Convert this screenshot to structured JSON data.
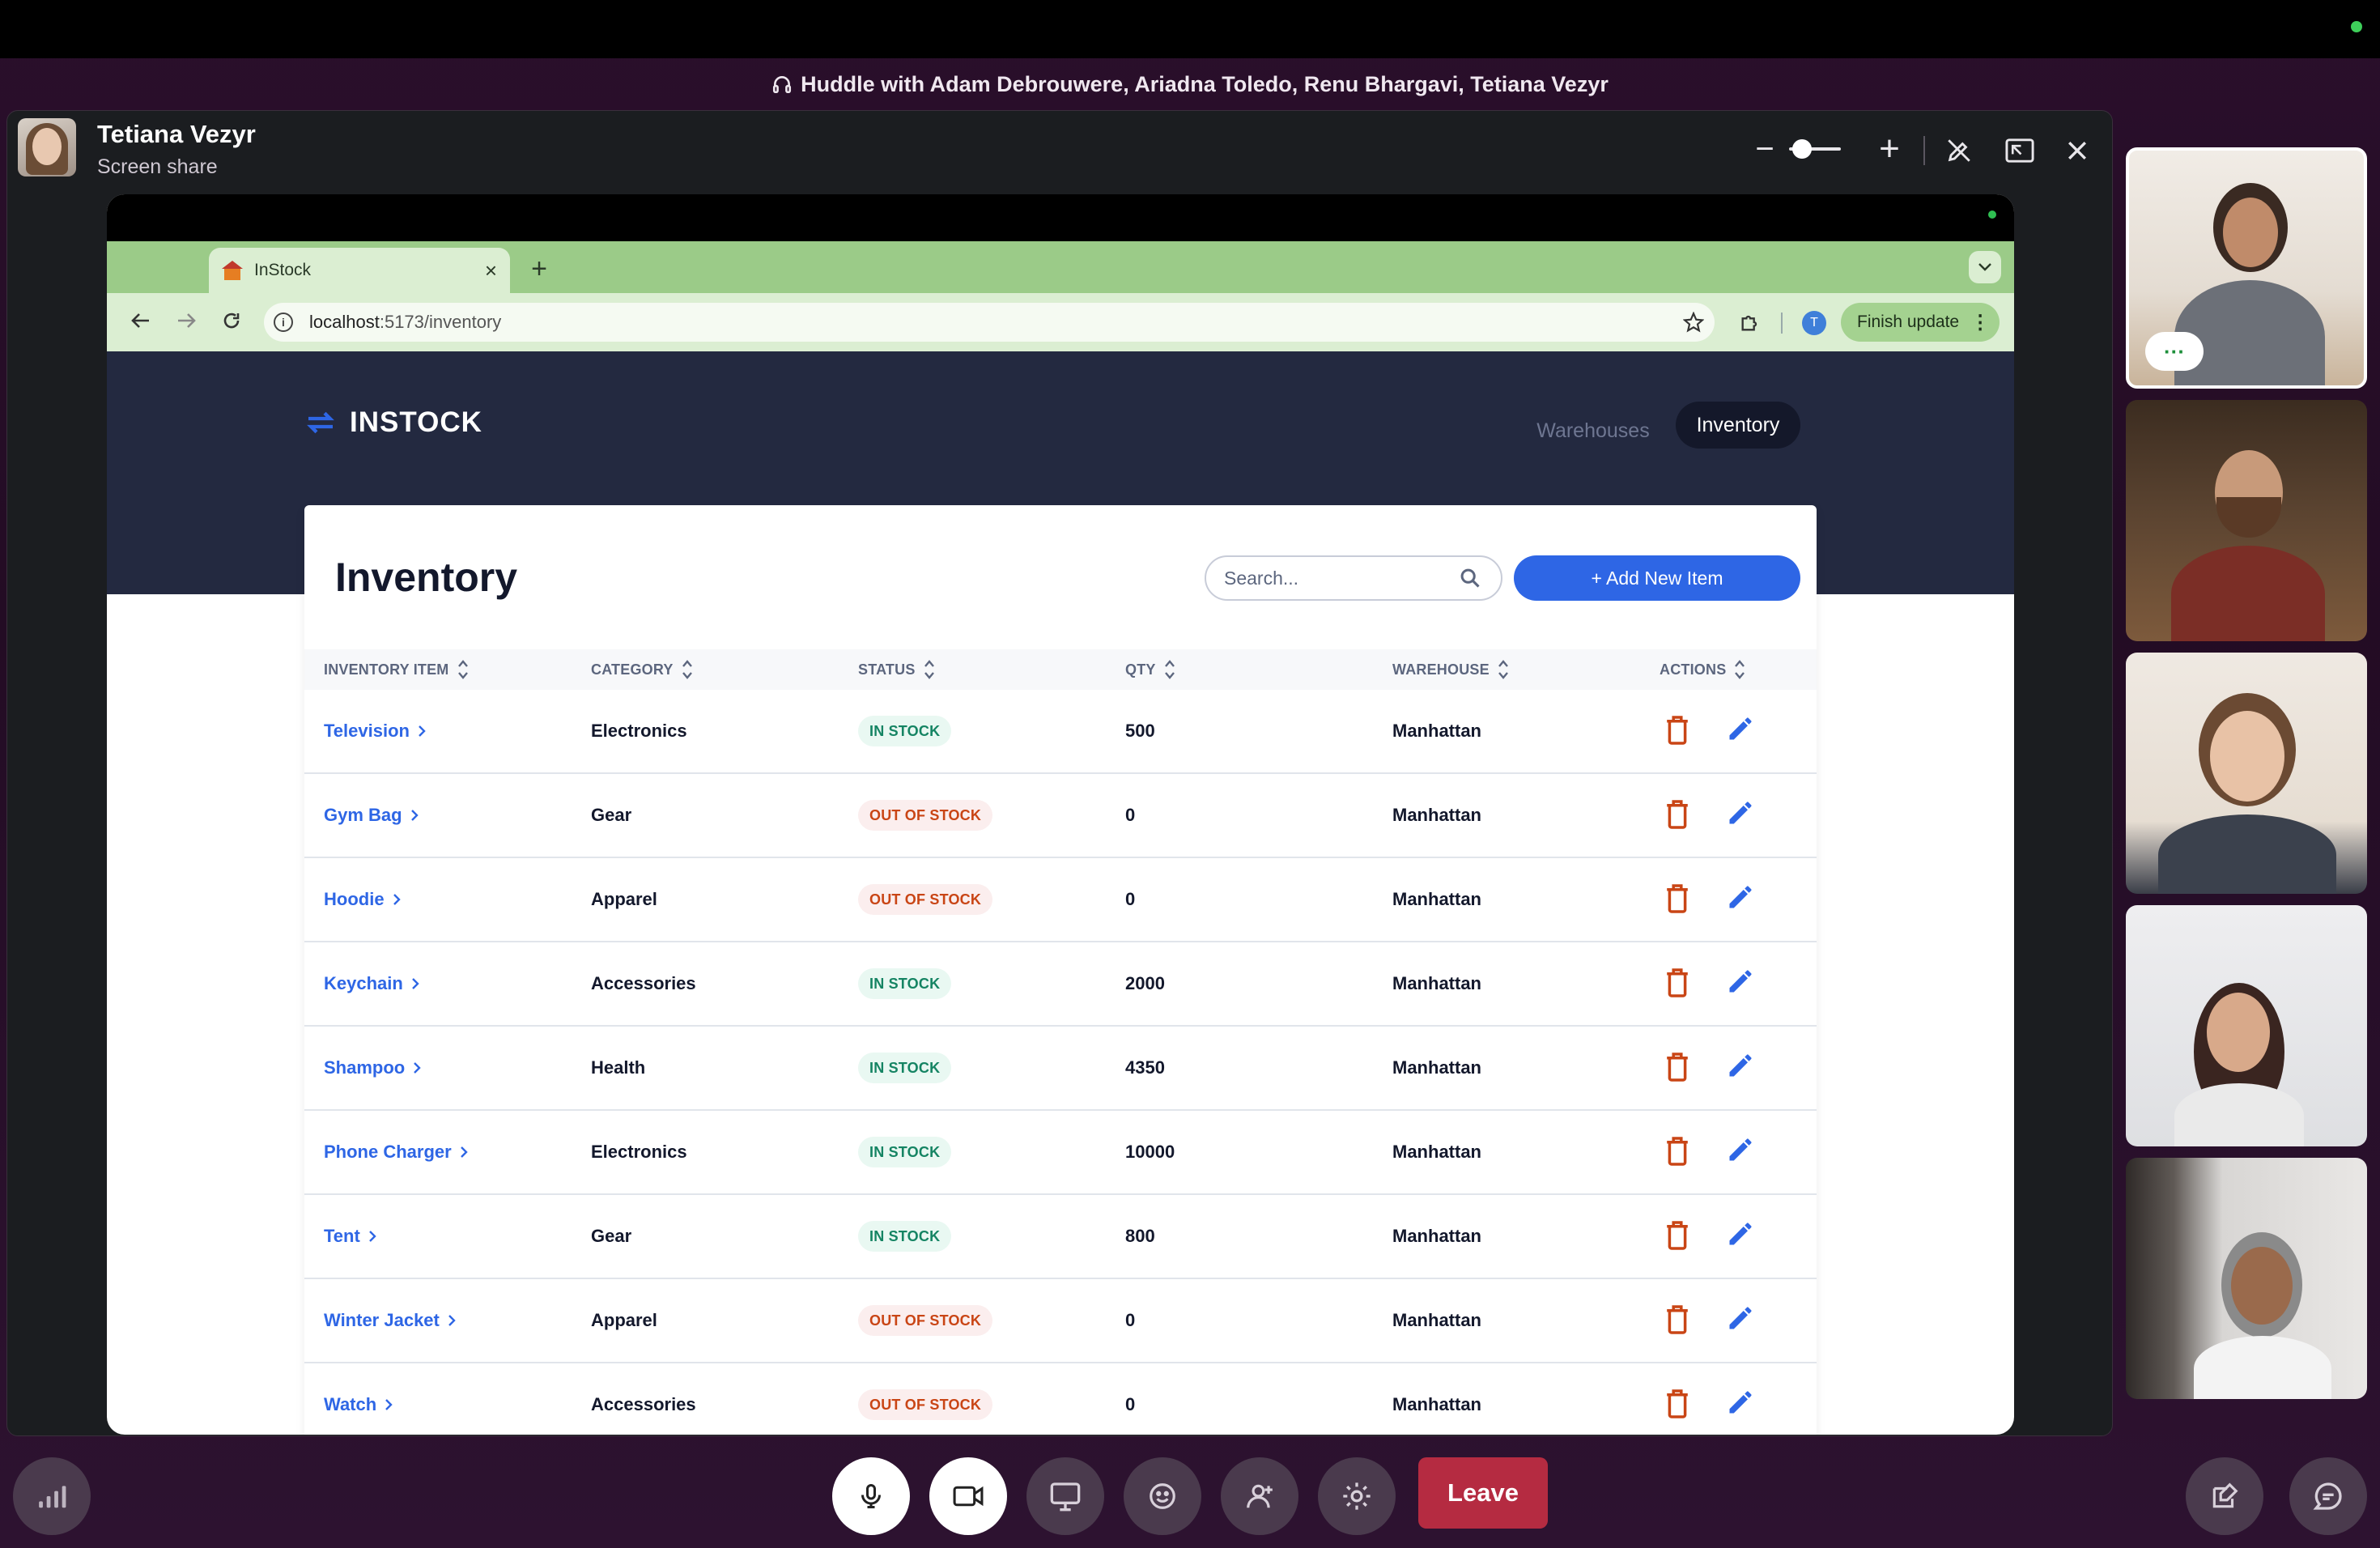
{
  "huddle": {
    "title": "Huddle with Adam Debrouwere, Ariadna Toledo, Renu Bhargavi, Tetiana Vezyr"
  },
  "share": {
    "sharer_name": "Tetiana Vezyr",
    "sharer_sub": "Screen share",
    "controls": {
      "zoom_out": "−",
      "zoom_in": "+"
    }
  },
  "browser": {
    "tab_title": "InStock",
    "tab_close": "×",
    "new_tab": "+",
    "url_host": "localhost",
    "url_path": ":5173/inventory",
    "profile_initial": "T",
    "finish_update": "Finish update"
  },
  "app": {
    "brand": "INSTOCK",
    "nav": {
      "warehouses": "Warehouses",
      "inventory": "Inventory"
    },
    "page_title": "Inventory",
    "search_placeholder": "Search...",
    "add_button": "+ Add New Item",
    "columns": [
      "INVENTORY ITEM",
      "CATEGORY",
      "STATUS",
      "QTY",
      "WAREHOUSE",
      "ACTIONS"
    ],
    "rows": [
      {
        "item": "Television",
        "category": "Electronics",
        "status": "IN STOCK",
        "qty": "500",
        "warehouse": "Manhattan"
      },
      {
        "item": "Gym Bag",
        "category": "Gear",
        "status": "OUT OF STOCK",
        "qty": "0",
        "warehouse": "Manhattan"
      },
      {
        "item": "Hoodie",
        "category": "Apparel",
        "status": "OUT OF STOCK",
        "qty": "0",
        "warehouse": "Manhattan"
      },
      {
        "item": "Keychain",
        "category": "Accessories",
        "status": "IN STOCK",
        "qty": "2000",
        "warehouse": "Manhattan"
      },
      {
        "item": "Shampoo",
        "category": "Health",
        "status": "IN STOCK",
        "qty": "4350",
        "warehouse": "Manhattan"
      },
      {
        "item": "Phone Charger",
        "category": "Electronics",
        "status": "IN STOCK",
        "qty": "10000",
        "warehouse": "Manhattan"
      },
      {
        "item": "Tent",
        "category": "Gear",
        "status": "IN STOCK",
        "qty": "800",
        "warehouse": "Manhattan"
      },
      {
        "item": "Winter Jacket",
        "category": "Apparel",
        "status": "OUT OF STOCK",
        "qty": "0",
        "warehouse": "Manhattan"
      },
      {
        "item": "Watch",
        "category": "Accessories",
        "status": "OUT OF STOCK",
        "qty": "0",
        "warehouse": "Manhattan"
      }
    ]
  },
  "footer": {
    "leave": "Leave"
  },
  "colors": {
    "accent_blue": "#2e66e5",
    "in_stock": "#158463",
    "out_of_stock": "#c94515",
    "leave_red": "#b52b41",
    "header_navy": "#232940"
  }
}
